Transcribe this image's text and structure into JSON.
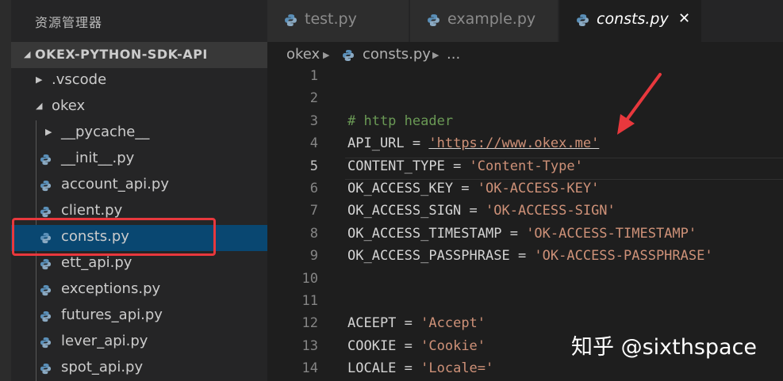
{
  "sidebar": {
    "title": "资源管理器",
    "project": "OKEX-PYTHON-SDK-API",
    "items": [
      {
        "label": ".vscode",
        "type": "folder",
        "expanded": false
      },
      {
        "label": "okex",
        "type": "folder",
        "expanded": true
      },
      {
        "label": "__pycache__",
        "type": "folder",
        "expanded": false
      },
      {
        "label": "__init__.py",
        "type": "file"
      },
      {
        "label": "account_api.py",
        "type": "file"
      },
      {
        "label": "client.py",
        "type": "file"
      },
      {
        "label": "consts.py",
        "type": "file",
        "selected": true
      },
      {
        "label": "ett_api.py",
        "type": "file"
      },
      {
        "label": "exceptions.py",
        "type": "file"
      },
      {
        "label": "futures_api.py",
        "type": "file"
      },
      {
        "label": "lever_api.py",
        "type": "file"
      },
      {
        "label": "spot_api.py",
        "type": "file"
      }
    ]
  },
  "tabs": [
    {
      "label": "test.py",
      "active": false
    },
    {
      "label": "example.py",
      "active": false
    },
    {
      "label": "consts.py",
      "active": true
    }
  ],
  "tab_close_symbol": "✕",
  "breadcrumb": {
    "folder": "okex",
    "file": "consts.py",
    "more": "..."
  },
  "editor": {
    "current_line": 5,
    "lines": [
      {
        "n": "1",
        "text": ""
      },
      {
        "n": "2",
        "text": ""
      },
      {
        "n": "3",
        "comment": "# http header"
      },
      {
        "n": "4",
        "name": "API_URL",
        "value": "'https://www.okex.me'"
      },
      {
        "n": "5",
        "name": "CONTENT_TYPE",
        "value": "'Content-Type'"
      },
      {
        "n": "6",
        "name": "OK_ACCESS_KEY",
        "value": "'OK-ACCESS-KEY'"
      },
      {
        "n": "7",
        "name": "OK_ACCESS_SIGN",
        "value": "'OK-ACCESS-SIGN'"
      },
      {
        "n": "8",
        "name": "OK_ACCESS_TIMESTAMP",
        "value": "'OK-ACCESS-TIMESTAMP'"
      },
      {
        "n": "9",
        "name": "OK_ACCESS_PASSPHRASE",
        "value": "'OK-ACCESS-PASSPHRASE'"
      },
      {
        "n": "10",
        "text": ""
      },
      {
        "n": "11",
        "text": ""
      },
      {
        "n": "12",
        "name": "ACEEPT",
        "value": "'Accept'"
      },
      {
        "n": "13",
        "name": "COOKIE",
        "value": "'Cookie'"
      },
      {
        "n": "14",
        "name": "LOCALE",
        "value": "'Locale='"
      }
    ]
  },
  "watermark": "知乎 @sixthspace",
  "colors": {
    "background": "#1e1e1e",
    "sidebar": "#252526",
    "selection": "#094771",
    "annotation_red": "#e8383d",
    "comment": "#6a9955",
    "string": "#ce9178"
  },
  "icons": {
    "file": "python-icon",
    "folder_collapsed": "chevron-right-icon",
    "folder_expanded": "chevron-down-icon"
  }
}
